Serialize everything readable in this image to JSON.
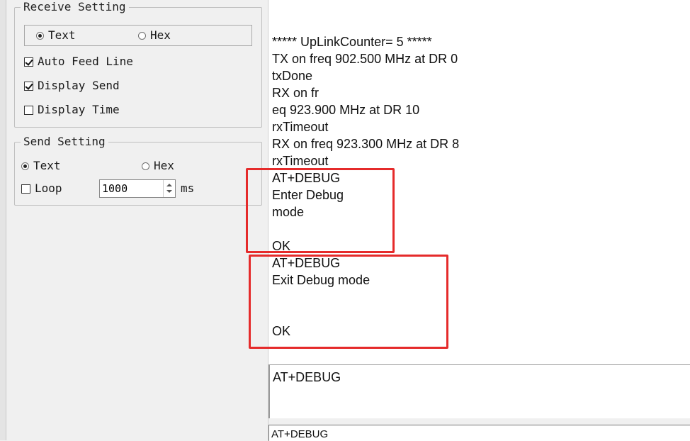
{
  "receive_setting": {
    "title": "Receive Setting",
    "text_label": "Text",
    "hex_label": "Hex",
    "selected": "Text",
    "auto_feed_line": "Auto Feed Line",
    "display_send": "Display Send",
    "display_time": "Display Time",
    "auto_feed_checked": true,
    "display_send_checked": true,
    "display_time_checked": false
  },
  "send_setting": {
    "title": "Send Setting",
    "text_label": "Text",
    "hex_label": "Hex",
    "selected": "Text",
    "loop_label": "Loop",
    "loop_checked": false,
    "interval_value": "1000",
    "interval_unit": "ms"
  },
  "receive_log": [
    "***** UpLinkCounter= 5 *****",
    "TX on freq 902.500 MHz at DR 0",
    "txDone",
    "RX on fr",
    "eq 923.900 MHz at DR 10",
    "rxTimeout",
    "RX on freq 923.300 MHz at DR 8",
    "rxTimeout",
    "AT+DEBUG",
    "Enter Debug",
    "mode",
    "",
    "OK",
    "AT+DEBUG",
    "Exit Debug mode",
    "",
    "",
    "OK"
  ],
  "send_area_text": "AT+DEBUG",
  "command_text": "AT+DEBUG",
  "colors": {
    "highlight": "#e52b2b",
    "panel_bg": "#f0f0f0"
  }
}
